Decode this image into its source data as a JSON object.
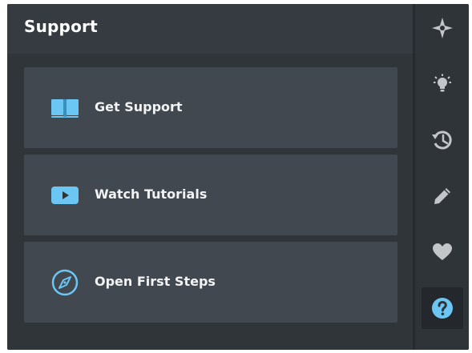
{
  "panel": {
    "title": "Support",
    "items": [
      {
        "label": "Get Support",
        "icon": "book-icon"
      },
      {
        "label": "Watch Tutorials",
        "icon": "video-play-icon"
      },
      {
        "label": "Open First Steps",
        "icon": "compass-icon"
      }
    ]
  },
  "sidebar": {
    "items": [
      {
        "icon": "sparkle-icon"
      },
      {
        "icon": "lightbulb-icon"
      },
      {
        "icon": "history-icon"
      },
      {
        "icon": "pencil-icon"
      },
      {
        "icon": "heart-icon"
      },
      {
        "icon": "help-icon",
        "active": true
      }
    ]
  },
  "colors": {
    "accent": "#6cc6f4",
    "panel_background": "#30353a",
    "card_background": "#424850",
    "icon_gray": "#c3c6c9"
  }
}
